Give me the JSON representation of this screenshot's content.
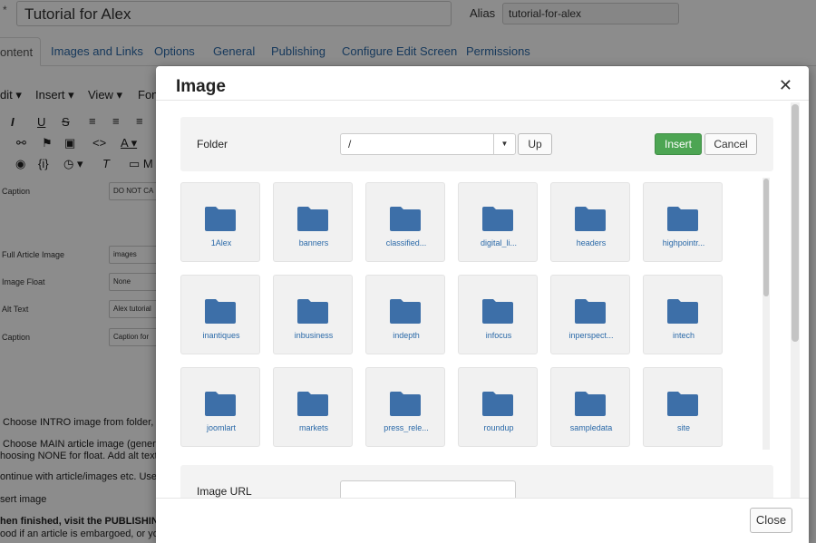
{
  "editor": {
    "title_value": "Tutorial for Alex",
    "title_marker": "*",
    "alias_label": "Alias",
    "alias_value": "tutorial-for-alex",
    "tabs": [
      "ontent",
      "Images and Links",
      "Options",
      "General",
      "Publishing",
      "Configure Edit Screen",
      "Permissions"
    ],
    "menu": [
      "dit ▾",
      "Insert ▾",
      "View ▾",
      "Fon"
    ],
    "fields": [
      {
        "label": "Caption",
        "value": "DO NOT CA"
      },
      {
        "label": "Full Article Image",
        "value": "images"
      },
      {
        "label": "Image Float",
        "value": "None"
      },
      {
        "label": "Alt Text",
        "value": "Alex tutorial"
      },
      {
        "label": "Caption",
        "value": "Caption for"
      }
    ],
    "body_lines": [
      "Choose INTRO image from folder, ad",
      "Choose MAIN article image (general",
      "hoosing NONE for float. Add alt text a",
      "ontinue with article/images etc. Use t",
      "sert image",
      "hen finished, visit the PUBLISHING",
      "ood if an article is embargoed, or you"
    ]
  },
  "modal": {
    "title": "Image",
    "close_glyph": "✕",
    "folder_label": "Folder",
    "folder_value": "/",
    "up_label": "Up",
    "insert_label": "Insert",
    "cancel_label": "Cancel",
    "image_url_label": "Image URL",
    "image_url_value": "",
    "close_button_label": "Close",
    "folders": [
      "1Alex",
      "banners",
      "classified...",
      "digital_li...",
      "headers",
      "highpointr...",
      "inantiques",
      "inbusiness",
      "indepth",
      "infocus",
      "inperspect...",
      "intech",
      "joomlart",
      "markets",
      "press_rele...",
      "roundup",
      "sampledata",
      "site"
    ]
  },
  "colors": {
    "folder_icon": "#3d6fa8",
    "insert_button": "#4da553",
    "link_text": "#2a69a8"
  }
}
